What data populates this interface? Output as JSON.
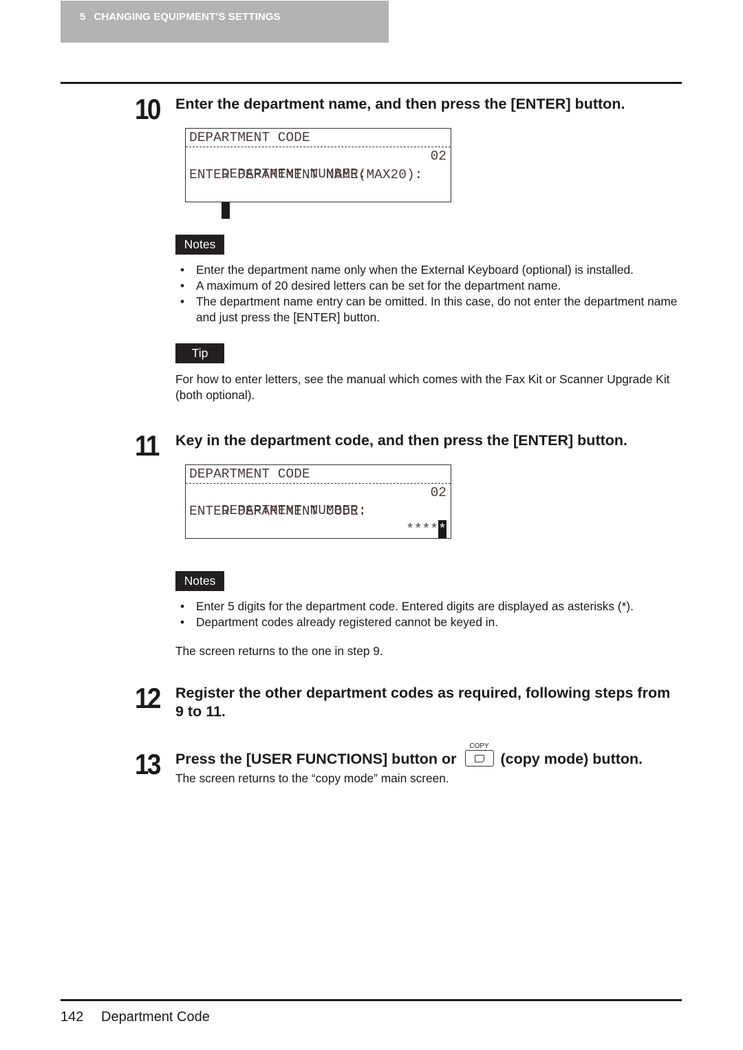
{
  "header": {
    "chapter_number": "5",
    "chapter_title": "CHANGING EQUIPMENT’S SETTINGS",
    "background_color": "#b3b3b3"
  },
  "steps": [
    {
      "number": "10",
      "title": "Enter the department name, and then press the [ENTER] button.",
      "lcd": {
        "line1": "DEPARTMENT CODE",
        "line2_label": "DEPARTMENT NUMBER:",
        "line2_value": "02",
        "line3": "ENTER DEPARTMENT NAME(MAX20):",
        "line4": ""
      },
      "notes_label": "Notes",
      "notes": [
        "Enter the department name only when the External Keyboard (optional) is installed.",
        "A maximum of 20 desired letters can be set for the department name.",
        "The department name entry can be omitted. In this case, do not enter the department name and just press the [ENTER] button."
      ],
      "tip_label": "Tip",
      "tip": "For how to enter letters, see the manual which comes with the Fax Kit or Scanner Upgrade Kit (both optional)."
    },
    {
      "number": "11",
      "title": "Key in the department code, and then press the [ENTER] button.",
      "lcd": {
        "line1": "DEPARTMENT CODE",
        "line2_label": "DEPARTMENT NUMBER:",
        "line2_value": "02",
        "line3": "ENTER DEPARTMENT CODE:",
        "line4_masked": "****",
        "line4_cursor": "*"
      },
      "notes_label": "Notes",
      "notes": [
        "Enter 5 digits for the department code. Entered digits are displayed as asterisks (*).",
        "Department codes already registered cannot be keyed in."
      ],
      "result": "The screen returns to the one in step 9."
    },
    {
      "number": "12",
      "title": "Register the other department codes as required, following steps from 9 to 11."
    },
    {
      "number": "13",
      "title_before": "Press the [USER FUNCTIONS] button or",
      "button_caption": "COPY",
      "button_icon": "copy-mode-icon",
      "title_after": "(copy mode) button.",
      "result": "The screen returns to the “copy mode” main screen."
    }
  ],
  "footer": {
    "page_number": "142",
    "section_title": "Department Code"
  }
}
